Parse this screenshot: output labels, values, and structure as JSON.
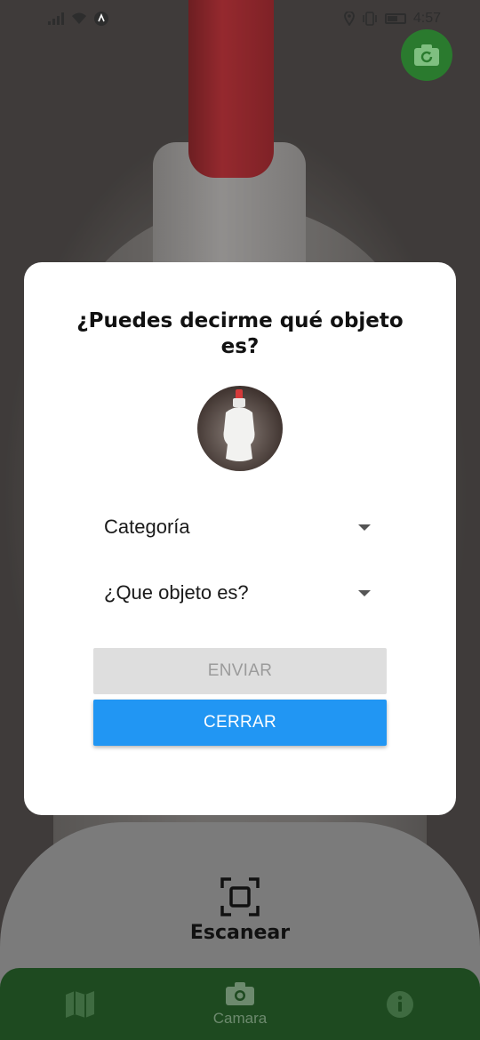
{
  "status_bar": {
    "time": "4:57"
  },
  "dialog": {
    "title": "¿Puedes decirme qué objeto es?",
    "category_dropdown": {
      "selected": "Categoría"
    },
    "object_dropdown": {
      "selected": "¿Que objeto es?"
    },
    "send_button": {
      "label": "ENVIAR",
      "enabled": false
    },
    "close_button": {
      "label": "CERRAR"
    }
  },
  "scan": {
    "label": "Escanear"
  },
  "bottom_nav": {
    "items": [
      {
        "icon": "map-icon",
        "label": ""
      },
      {
        "icon": "camera-icon",
        "label": "Camara"
      },
      {
        "icon": "info-icon",
        "label": ""
      }
    ]
  },
  "colors": {
    "accent_blue": "#2196f3",
    "nav_green": "#1e4a20",
    "fab_green": "#2a7a2e"
  }
}
